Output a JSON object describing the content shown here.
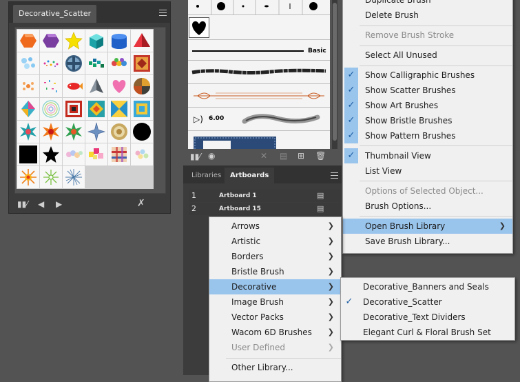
{
  "scatter_panel": {
    "tab_title": "Decorative_Scatter",
    "swatches": [
      "orange-hexagon",
      "purple-hexagon",
      "yellow-star",
      "teal-cube",
      "blue-cylinder",
      "red-pyramid",
      "bubble-cluster",
      "confetti-dots",
      "blue-button-disc",
      "green-blocks",
      "color-spheres",
      "framed-diamond",
      "dot-flower",
      "sprinkle-dots",
      "fish-shape",
      "gray-cone",
      "pink-heart",
      "color-wheel",
      "crystal-diamond",
      "concentric-rings",
      "square-spiral",
      "diamond-in-square",
      "arrow-diamond",
      "nested-squares",
      "teal-starburst",
      "orange-starburst",
      "green-starburst",
      "blue-star",
      "gold-disc",
      "black-circle",
      "black-square",
      "black-star",
      "pastel-blobs",
      "mosaic-squares",
      "plaid-pattern",
      "pastel-dots",
      "orange-sun",
      "green-burst",
      "blue-spark"
    ],
    "bottom_icons": [
      "libraries-icon",
      "previous-arrow-icon",
      "next-arrow-icon",
      "delete-brush-icon"
    ]
  },
  "brush_panel": {
    "basic_label": "Basic",
    "size_label": "6.00",
    "toolbar_icons": [
      "libraries-icon",
      "scatter-options-icon",
      "remove-stroke-icon",
      "brush-options-icon",
      "new-brush-icon",
      "delete-icon"
    ]
  },
  "artboards_panel": {
    "tabs": [
      "Libraries",
      "Artboards"
    ],
    "rows": [
      {
        "num": "1",
        "name": "Artboard 1"
      },
      {
        "num": "2",
        "name": "Artboard 15"
      }
    ]
  },
  "panel_menu": {
    "items": [
      {
        "label": "Duplicate Brush"
      },
      {
        "label": "Delete Brush"
      },
      {
        "label": "Remove Brush Stroke"
      },
      {
        "label": "Select All Unused"
      },
      {
        "label": "Show Calligraphic Brushes"
      },
      {
        "label": "Show Scatter Brushes"
      },
      {
        "label": "Show Art Brushes"
      },
      {
        "label": "Show Bristle Brushes"
      },
      {
        "label": "Show Pattern Brushes"
      },
      {
        "label": "Thumbnail View"
      },
      {
        "label": "List View"
      },
      {
        "label": "Options of Selected Object..."
      },
      {
        "label": "Brush Options..."
      },
      {
        "label": "Open Brush Library"
      },
      {
        "label": "Save Brush Library..."
      }
    ]
  },
  "library_menu": {
    "items": [
      {
        "label": "Arrows"
      },
      {
        "label": "Artistic"
      },
      {
        "label": "Borders"
      },
      {
        "label": "Bristle Brush"
      },
      {
        "label": "Decorative"
      },
      {
        "label": "Image Brush"
      },
      {
        "label": "Vector Packs"
      },
      {
        "label": "Wacom 6D Brushes"
      },
      {
        "label": "User Defined"
      },
      {
        "label": "Other Library..."
      }
    ]
  },
  "decorative_menu": {
    "items": [
      {
        "label": "Decorative_Banners and Seals"
      },
      {
        "label": "Decorative_Scatter"
      },
      {
        "label": "Decorative_Text Dividers"
      },
      {
        "label": "Elegant Curl & Floral Brush Set"
      }
    ]
  },
  "colors": {
    "highlight": "#99c4ec",
    "check": "#1b5ea4",
    "panel_bg": "#535353",
    "panel_dark": "#3c3c3c"
  }
}
